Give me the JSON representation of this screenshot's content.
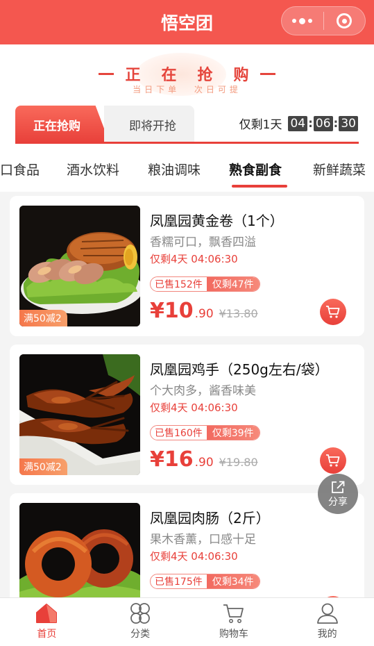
{
  "header": {
    "title": "悟空团"
  },
  "hero": {
    "slogan_chars": [
      "正",
      "在",
      "抢",
      "购"
    ],
    "sub_left": "当日下单",
    "sub_right": "次日可提"
  },
  "tabs": {
    "active": "正在抢购",
    "inactive": "即将开抢"
  },
  "countdown": {
    "label": "仅剩1天",
    "hours": "04",
    "minutes": "06",
    "seconds": "30"
  },
  "categories": [
    "口食品",
    "酒水饮料",
    "粮油调味",
    "熟食副食",
    "新鲜蔬菜"
  ],
  "active_category": "熟食副食",
  "products": [
    {
      "name": "凤凰园黄金卷（1个）",
      "desc": "香糯可口，飘香四溢",
      "remain": "仅剩4天 04:06:30",
      "sold": "已售152件",
      "left": "仅剩47件",
      "price_main": "¥10",
      "price_dec": ".90",
      "price_orig": "¥13.80",
      "promo": "满50减2",
      "image": "roast-roll-image"
    },
    {
      "name": "凤凰园鸡手（250g左右/袋）",
      "desc": "个大肉多，酱香味美",
      "remain": "仅剩4天 04:06:30",
      "sold": "已售160件",
      "left": "仅剩39件",
      "price_main": "¥16",
      "price_dec": ".90",
      "price_orig": "¥19.80",
      "promo": "满50减2",
      "image": "braised-chicken-feet-image"
    },
    {
      "name": "凤凰园肉肠（2斤）",
      "desc": "果木香薰，口感十足",
      "remain": "仅剩4天 04:06:30",
      "sold": "已售175件",
      "left": "仅剩34件",
      "image": "sausage-image"
    }
  ],
  "share": {
    "label": "分享"
  },
  "tabbar": [
    {
      "label": "首页",
      "icon": "home-icon",
      "active": true
    },
    {
      "label": "分类",
      "icon": "category-icon",
      "active": false
    },
    {
      "label": "购物车",
      "icon": "cart-icon",
      "active": false
    },
    {
      "label": "我的",
      "icon": "user-icon",
      "active": false
    }
  ],
  "colors": {
    "brand": "#f4574f",
    "accent": "#e8403a",
    "muted": "#888888"
  }
}
